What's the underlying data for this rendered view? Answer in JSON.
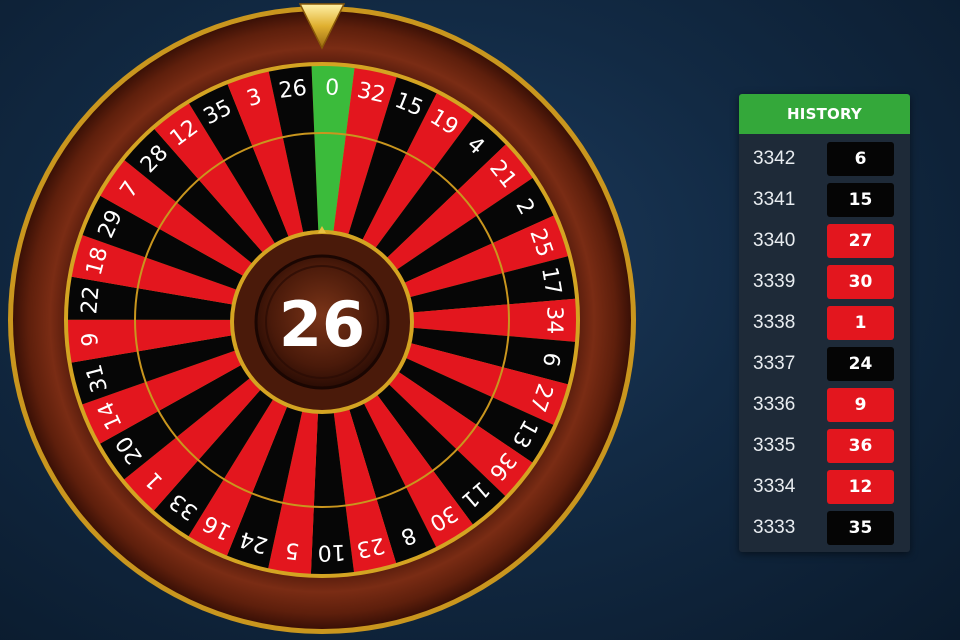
{
  "wheel": {
    "pockets": [
      "0",
      "32",
      "15",
      "19",
      "4",
      "21",
      "2",
      "25",
      "17",
      "34",
      "6",
      "27",
      "13",
      "36",
      "11",
      "30",
      "8",
      "23",
      "10",
      "5",
      "24",
      "16",
      "33",
      "1",
      "20",
      "14",
      "31",
      "9",
      "22",
      "18",
      "29",
      "7",
      "28",
      "12",
      "35",
      "3",
      "26"
    ],
    "pocket_colors": [
      "green",
      "red",
      "black",
      "red",
      "black",
      "red",
      "black",
      "red",
      "black",
      "red",
      "black",
      "red",
      "black",
      "red",
      "black",
      "red",
      "black",
      "red",
      "black",
      "red",
      "black",
      "red",
      "black",
      "red",
      "black",
      "red",
      "black",
      "red",
      "black",
      "red",
      "black",
      "red",
      "black",
      "red",
      "black",
      "red",
      "black"
    ],
    "current_result": "26",
    "colors": {
      "red": "#e3161e",
      "black": "#060606",
      "green": "#3bbb3b",
      "gold": "#d9a826",
      "wood": "#6b2512"
    }
  },
  "pointer_icon": "triangle-pointer-icon",
  "history": {
    "title": "HISTORY",
    "rows": [
      {
        "round": "3342",
        "number": "6",
        "color": "black"
      },
      {
        "round": "3341",
        "number": "15",
        "color": "black"
      },
      {
        "round": "3340",
        "number": "27",
        "color": "red"
      },
      {
        "round": "3339",
        "number": "30",
        "color": "red"
      },
      {
        "round": "3338",
        "number": "1",
        "color": "red"
      },
      {
        "round": "3337",
        "number": "24",
        "color": "black"
      },
      {
        "round": "3336",
        "number": "9",
        "color": "red"
      },
      {
        "round": "3335",
        "number": "36",
        "color": "red"
      },
      {
        "round": "3334",
        "number": "12",
        "color": "red"
      },
      {
        "round": "3333",
        "number": "35",
        "color": "black"
      }
    ]
  }
}
